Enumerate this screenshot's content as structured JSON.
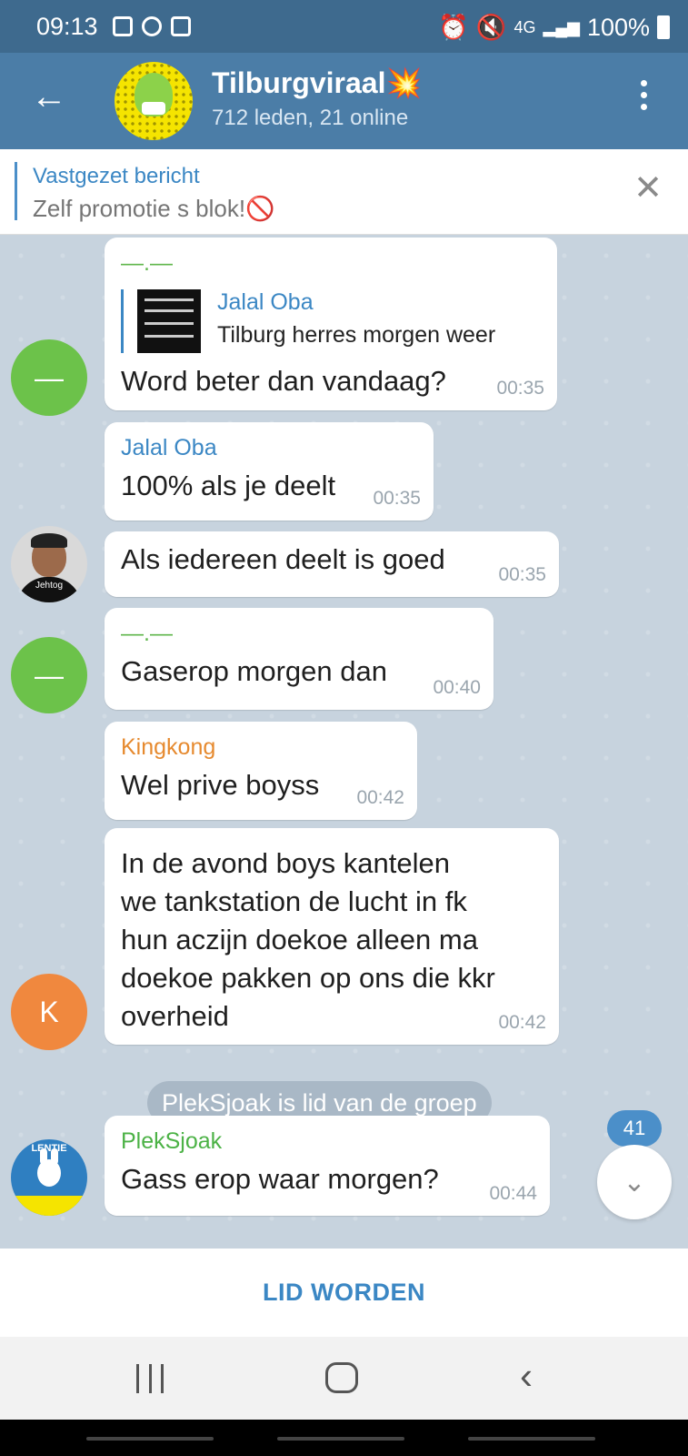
{
  "status_bar": {
    "time": "09:13",
    "battery": "100%",
    "network": "4G"
  },
  "header": {
    "back_icon": "arrow-left-icon",
    "title": "Tilburgviraal💥",
    "subtitle": "712 leden, 21 online"
  },
  "pinned": {
    "label": "Vastgezet bericht",
    "text": "Zelf promotie s blok!🚫"
  },
  "messages": [
    {
      "avatar_letter": "—",
      "sender": "—.—",
      "reply_to": {
        "name": "Jalal Oba",
        "text": "Tilburg herres morgen weer"
      },
      "text": "Word beter dan vandaag?",
      "time": "00:35"
    },
    {
      "sender": "Jalal Oba",
      "text": "100% als je deelt",
      "time": "00:35"
    },
    {
      "avatar_caption": "Jehtog",
      "text": "Als iedereen deelt is goed",
      "time": "00:35"
    },
    {
      "avatar_letter": "—",
      "sender": "—.—",
      "text": "Gaserop morgen dan",
      "time": "00:40"
    },
    {
      "sender": "Kingkong",
      "text": "Wel prive boyss",
      "time": "00:42"
    },
    {
      "avatar_letter": "K",
      "lines": [
        "In de avond boys kantelen",
        "we tankstation de lucht in fk",
        "hun aczijn doekoe alleen ma",
        "doekoe pakken op ons die kkr",
        "overheid"
      ],
      "time": "00:42"
    },
    {
      "avatar_caption": "LENTIE",
      "sender": "PlekSjoak",
      "text": "Gass erop waar morgen?",
      "time": "00:44"
    }
  ],
  "service_message": "PlekSjoak is lid van de groep",
  "unread_count": "41",
  "join_button": "LID WORDEN"
}
